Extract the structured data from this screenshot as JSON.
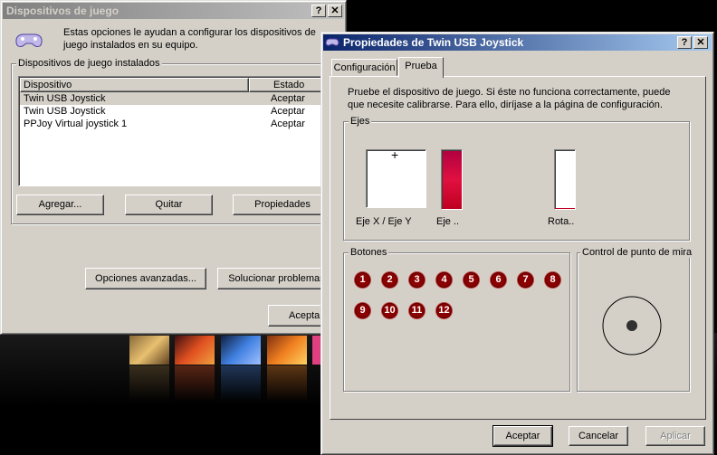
{
  "back_window": {
    "title": "Dispositivos de juego",
    "intro": "Estas opciones le ayudan a configurar los dispositivos de juego instalados en su equipo.",
    "group_label": "Dispositivos de juego instalados",
    "columns": [
      "Dispositivo",
      "Estado"
    ],
    "rows": [
      {
        "device": "Twin USB Joystick",
        "status": "Aceptar"
      },
      {
        "device": "Twin USB Joystick",
        "status": "Aceptar"
      },
      {
        "device": "PPJoy Virtual joystick 1",
        "status": "Aceptar"
      }
    ],
    "buttons": {
      "add": "Agregar...",
      "remove": "Quitar",
      "properties": "Propiedades",
      "advanced": "Opciones avanzadas...",
      "troubleshoot": "Solucionar problemas...",
      "ok": "Aceptar"
    }
  },
  "front_window": {
    "title": "Propiedades de Twin USB Joystick",
    "tabs": [
      "Configuración",
      "Prueba"
    ],
    "active_tab": "Prueba",
    "description": "Pruebe el dispositivo de juego. Si éste no funciona correctamente, puede que necesite calibrarse. Para ello, diríjase a la página de configuración.",
    "axes": {
      "label": "Ejes",
      "xy_label": "Eje X / Eje Y",
      "z_label": "Eje ..",
      "rot_label": "Rota.."
    },
    "buttons_group": {
      "label": "Botones",
      "numbers": [
        "1",
        "2",
        "3",
        "4",
        "5",
        "6",
        "7",
        "8",
        "9",
        "10",
        "11",
        "12"
      ]
    },
    "pov": {
      "label": "Control de punto de mira"
    },
    "footer": {
      "ok": "Aceptar",
      "cancel": "Cancelar",
      "apply": "Aplicar"
    }
  },
  "colors": {
    "active_title_start": "#0a246a",
    "active_title_end": "#a6caf0",
    "button_red": "#8b0000"
  }
}
